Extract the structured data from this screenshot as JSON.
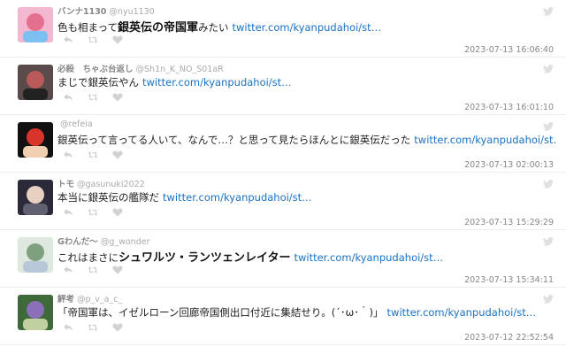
{
  "tweets": [
    {
      "name": "バンナ1130",
      "handle": "@nyu1130",
      "text_before": "色も相まって",
      "text_emph": "銀英伝の帝国軍",
      "text_after": "みたい",
      "link": "twitter.com/kyanpudahoi/st…",
      "date": "2023-07-13 16:06:40",
      "avatar_colors": [
        "#f3b7d0",
        "#e3708f",
        "#7bc0f0"
      ]
    },
    {
      "name": "必殺　ちゃぶ台返し",
      "handle": "@Sh1n_K_NO_S01aR",
      "text_before": "まじで銀英伝やん",
      "text_emph": "",
      "text_after": "",
      "link": "twitter.com/kyanpudahoi/st…",
      "date": "2023-07-13 16:01:10",
      "avatar_colors": [
        "#5a4a4a",
        "#b85a5a",
        "#222222"
      ]
    },
    {
      "name": "",
      "handle": "@refeia",
      "text_before": "銀英伝って言ってる人いて、なんで…？と思って見たらほんとに銀英伝だった",
      "text_emph": "",
      "text_after": "",
      "link": "twitter.com/kyanpudahoi/st…",
      "date": "2023-07-13 02:00:13",
      "avatar_colors": [
        "#111111",
        "#d8342a",
        "#f0d0b0"
      ]
    },
    {
      "name": "トモ",
      "handle": "@gasunuki2022",
      "text_before": "本当に銀英伝の艦隊だ",
      "text_emph": "",
      "text_after": "",
      "link": "twitter.com/kyanpudahoi/st…",
      "date": "2023-07-13 15:29:29",
      "avatar_colors": [
        "#2a2a3a",
        "#e8d0c0",
        "#606070"
      ]
    },
    {
      "name": "Gわんだ〜",
      "handle": "@g_wonder",
      "text_before": "これはまさに",
      "text_emph": "シュワルツ・ランツェンレイター",
      "text_after": "",
      "link": "twitter.com/kyanpudahoi/st…",
      "date": "2023-07-13 15:34:11",
      "avatar_colors": [
        "#dfe8df",
        "#7fa07f",
        "#b8c8d8"
      ]
    },
    {
      "name": "鮃考",
      "handle": "@p_v_a_c_",
      "text_before": "「帝国軍は、イゼルローン回廊帝国側出口付近に集結せり。(´･ω･｀)」",
      "text_emph": "",
      "text_after": "",
      "link": "twitter.com/kyanpudahoi/st…",
      "date": "2023-07-12 22:52:54",
      "avatar_colors": [
        "#3e6a3a",
        "#8a70b8",
        "#c0d0a0"
      ]
    }
  ],
  "icons": {
    "reply": "reply-icon",
    "retweet": "retweet-icon",
    "like": "heart-icon",
    "source": "twitter-bird-icon"
  }
}
